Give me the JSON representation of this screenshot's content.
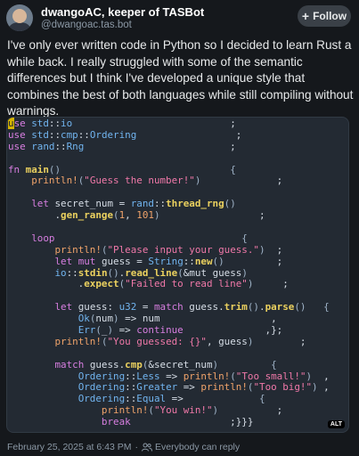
{
  "post": {
    "display_name": "dwangoAC, keeper of TASBot",
    "handle": "@dwangoac.tas.bot",
    "follow_label": "Follow",
    "text": "I've only ever written code in Python so I decided to learn Rust a while back. I really struggled with some of the semantic differences but I think I've developed a unique style that combines the best of both languages while still compiling without warnings.",
    "alt_badge": "ALT",
    "date": "February 25, 2025 at 6:43 PM",
    "separator": "·",
    "reply_setting": "Everybody can reply"
  },
  "code_lines": [
    [
      [
        "cursor",
        "u"
      ],
      [
        "k",
        "se "
      ],
      [
        "ty",
        "std"
      ],
      [
        "",
        "::"
      ],
      [
        "ty",
        "io"
      ],
      [
        "",
        "                           ;"
      ]
    ],
    [
      [
        "k",
        "use "
      ],
      [
        "ty",
        "std"
      ],
      [
        "",
        "::"
      ],
      [
        "ty",
        "cmp"
      ],
      [
        "",
        "::"
      ],
      [
        "ty",
        "Ordering"
      ],
      [
        "",
        "                 ;"
      ]
    ],
    [
      [
        "k",
        "use "
      ],
      [
        "ty",
        "rand"
      ],
      [
        "",
        "::"
      ],
      [
        "ty",
        "Rng"
      ],
      [
        "",
        "                         ;"
      ]
    ],
    [
      [
        "",
        ""
      ]
    ],
    [
      [
        "k",
        "fn "
      ],
      [
        "fn",
        "main"
      ],
      [
        "br",
        "()"
      ],
      [
        "",
        "                             "
      ],
      [
        "br",
        "{"
      ]
    ],
    [
      [
        "",
        "    "
      ],
      [
        "m",
        "println!"
      ],
      [
        "br",
        "("
      ],
      [
        "s",
        "\"Guess the number!\""
      ],
      [
        "br",
        ")"
      ],
      [
        "",
        "             ;"
      ]
    ],
    [
      [
        "",
        ""
      ]
    ],
    [
      [
        "",
        "    "
      ],
      [
        "k",
        "let "
      ],
      [
        "",
        "secret_num = "
      ],
      [
        "ty",
        "rand"
      ],
      [
        "",
        "::"
      ],
      [
        "fn",
        "thread_rng"
      ],
      [
        "br",
        "()"
      ]
    ],
    [
      [
        "",
        "        ."
      ],
      [
        "fn",
        "gen_range"
      ],
      [
        "br",
        "("
      ],
      [
        "n",
        "1"
      ],
      [
        "",
        ", "
      ],
      [
        "n",
        "101"
      ],
      [
        "br",
        ")"
      ],
      [
        "",
        "                 ;"
      ]
    ],
    [
      [
        "",
        ""
      ]
    ],
    [
      [
        "",
        "    "
      ],
      [
        "k",
        "loop"
      ],
      [
        "",
        "                                "
      ],
      [
        "br",
        "{"
      ]
    ],
    [
      [
        "",
        "        "
      ],
      [
        "m",
        "println!"
      ],
      [
        "br",
        "("
      ],
      [
        "s",
        "\"Please input your guess.\""
      ],
      [
        "br",
        ")"
      ],
      [
        "",
        "  ;"
      ]
    ],
    [
      [
        "",
        "        "
      ],
      [
        "k",
        "let mut "
      ],
      [
        "",
        "guess = "
      ],
      [
        "ty",
        "String"
      ],
      [
        "",
        "::"
      ],
      [
        "fn",
        "new"
      ],
      [
        "br",
        "()"
      ],
      [
        "",
        "         ;"
      ]
    ],
    [
      [
        "",
        "        "
      ],
      [
        "ty",
        "io"
      ],
      [
        "",
        "::"
      ],
      [
        "fn",
        "stdin"
      ],
      [
        "br",
        "()"
      ],
      [
        "",
        "."
      ],
      [
        "fn",
        "read_line"
      ],
      [
        "br",
        "("
      ],
      [
        "",
        "&mut guess"
      ],
      [
        "br",
        ")"
      ]
    ],
    [
      [
        "",
        "            ."
      ],
      [
        "fn",
        "expect"
      ],
      [
        "br",
        "("
      ],
      [
        "s",
        "\"Failed to read line\""
      ],
      [
        "br",
        ")"
      ],
      [
        "",
        "     ;"
      ]
    ],
    [
      [
        "",
        ""
      ]
    ],
    [
      [
        "",
        "        "
      ],
      [
        "k",
        "let "
      ],
      [
        "",
        "guess: "
      ],
      [
        "ty",
        "u32"
      ],
      [
        "",
        " = "
      ],
      [
        "k",
        "match "
      ],
      [
        "",
        "guess."
      ],
      [
        "fn",
        "trim"
      ],
      [
        "br",
        "()"
      ],
      [
        "",
        "."
      ],
      [
        "fn",
        "parse"
      ],
      [
        "br",
        "()"
      ],
      [
        "",
        "   "
      ],
      [
        "br",
        "{"
      ]
    ],
    [
      [
        "",
        "            "
      ],
      [
        "ty",
        "Ok"
      ],
      [
        "br",
        "("
      ],
      [
        "",
        "num"
      ],
      [
        "br",
        ")"
      ],
      [
        "",
        " => num                   ,"
      ]
    ],
    [
      [
        "",
        "            "
      ],
      [
        "ty",
        "Err"
      ],
      [
        "br",
        "("
      ],
      [
        "",
        "_"
      ],
      [
        "br",
        ")"
      ],
      [
        "",
        " => "
      ],
      [
        "k",
        "continue"
      ],
      [
        "",
        "              ,};"
      ]
    ],
    [
      [
        "",
        "        "
      ],
      [
        "m",
        "println!"
      ],
      [
        "br",
        "("
      ],
      [
        "s",
        "\"You guessed: {}\""
      ],
      [
        "",
        ", guess"
      ],
      [
        "br",
        ")"
      ],
      [
        "",
        "        ;"
      ]
    ],
    [
      [
        "",
        ""
      ]
    ],
    [
      [
        "",
        "        "
      ],
      [
        "k",
        "match "
      ],
      [
        "",
        "guess."
      ],
      [
        "fn",
        "cmp"
      ],
      [
        "br",
        "("
      ],
      [
        "",
        "&secret_num"
      ],
      [
        "br",
        ")"
      ],
      [
        "",
        "         "
      ],
      [
        "br",
        "{"
      ]
    ],
    [
      [
        "",
        "            "
      ],
      [
        "ty",
        "Ordering"
      ],
      [
        "",
        "::"
      ],
      [
        "ty",
        "Less"
      ],
      [
        "",
        " => "
      ],
      [
        "m",
        "println!"
      ],
      [
        "br",
        "("
      ],
      [
        "s",
        "\"Too small!\""
      ],
      [
        "br",
        ")"
      ],
      [
        "",
        "  ,"
      ]
    ],
    [
      [
        "",
        "            "
      ],
      [
        "ty",
        "Ordering"
      ],
      [
        "",
        "::"
      ],
      [
        "ty",
        "Greater"
      ],
      [
        "",
        " => "
      ],
      [
        "m",
        "println!"
      ],
      [
        "br",
        "("
      ],
      [
        "s",
        "\"Too big!\""
      ],
      [
        "br",
        ")"
      ],
      [
        "",
        " ,"
      ]
    ],
    [
      [
        "",
        "            "
      ],
      [
        "ty",
        "Ordering"
      ],
      [
        "",
        "::"
      ],
      [
        "ty",
        "Equal"
      ],
      [
        "",
        " =>"
      ],
      [
        "",
        "             "
      ],
      [
        "br",
        "{"
      ]
    ],
    [
      [
        "",
        "                "
      ],
      [
        "m",
        "println!"
      ],
      [
        "br",
        "("
      ],
      [
        "s",
        "\"You win!\""
      ],
      [
        "br",
        ")"
      ],
      [
        "",
        "          ;"
      ]
    ],
    [
      [
        "",
        "                "
      ],
      [
        "k",
        "break"
      ],
      [
        "",
        "                 ;}}}"
      ]
    ]
  ]
}
